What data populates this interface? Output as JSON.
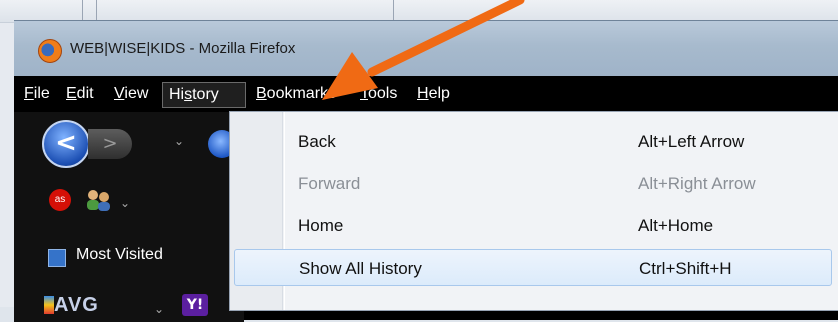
{
  "window": {
    "title": "WEB|WISE|KIDS - Mozilla Firefox"
  },
  "menubar": {
    "items": [
      {
        "label": "File",
        "accel": "F",
        "rest": "ile"
      },
      {
        "label": "Edit",
        "accel": "E",
        "rest": "dit"
      },
      {
        "label": "View",
        "accel": "V",
        "rest": "iew"
      },
      {
        "label": "History",
        "pre": "Hi",
        "accel": "s",
        "rest": "tory",
        "active": true
      },
      {
        "label": "Bookmarks",
        "accel": "B",
        "rest": "ookmarks"
      },
      {
        "label": "Tools",
        "accel": "T",
        "rest": "ools"
      },
      {
        "label": "Help",
        "accel": "H",
        "rest": "elp"
      }
    ]
  },
  "toolbar": {
    "back_glyph": "<",
    "forward_glyph": ">",
    "dropdown_glyph": "⌄",
    "lastfm_label": "as",
    "bookmarks": {
      "most_visited": "Most Visited"
    },
    "avg_label": "AVG",
    "yahoo_label": "Y!"
  },
  "history_menu": {
    "items": [
      {
        "label": "Back",
        "shortcut": "Alt+Left Arrow",
        "enabled": true
      },
      {
        "label": "Forward",
        "shortcut": "Alt+Right Arrow",
        "enabled": false
      },
      {
        "label": "Home",
        "shortcut": "Alt+Home",
        "enabled": true
      },
      {
        "label": "Show All History",
        "shortcut": "Ctrl+Shift+H",
        "enabled": true,
        "highlighted": true
      }
    ]
  },
  "annotation": {
    "arrow_color": "#f06a14"
  }
}
